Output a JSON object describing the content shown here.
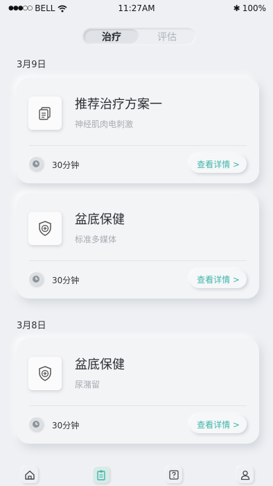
{
  "status_bar": {
    "carrier": "BELL",
    "time": "11:27AM",
    "battery": "100%"
  },
  "segmented": {
    "tabs": [
      {
        "label": "治疗",
        "active": true
      },
      {
        "label": "评估",
        "active": false
      }
    ]
  },
  "groups": [
    {
      "date": "3月9日",
      "cards": [
        {
          "title": "推荐治疗方案一",
          "subtitle": "神经肌肉电刺激",
          "icon": "document-icon",
          "duration": "30分钟",
          "action": "查看详情 >"
        },
        {
          "title": "盆底保健",
          "subtitle": "标准多媒体",
          "icon": "shield-plus-icon",
          "duration": "30分钟",
          "action": "查看详情 >"
        }
      ]
    },
    {
      "date": "3月8日",
      "cards": [
        {
          "title": "盆底保健",
          "subtitle": "尿潴留",
          "icon": "shield-plus-icon",
          "duration": "30分钟",
          "action": "查看详情 >"
        }
      ]
    }
  ],
  "tab_bar": {
    "items": [
      {
        "icon": "home-icon",
        "active": false
      },
      {
        "icon": "clipboard-icon",
        "active": true
      },
      {
        "icon": "help-icon",
        "active": false
      },
      {
        "icon": "user-icon",
        "active": false
      }
    ]
  },
  "colors": {
    "accent": "#3fb5a9",
    "background": "#eef0f3"
  }
}
